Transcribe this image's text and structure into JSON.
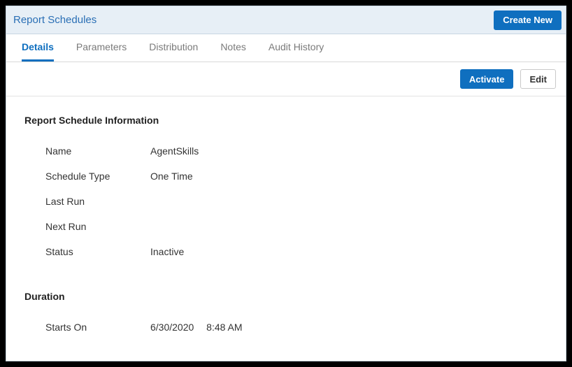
{
  "header": {
    "title": "Report Schedules",
    "create_label": "Create New"
  },
  "tabs": {
    "details": "Details",
    "parameters": "Parameters",
    "distribution": "Distribution",
    "notes": "Notes",
    "audit_history": "Audit History"
  },
  "actions": {
    "activate": "Activate",
    "edit": "Edit"
  },
  "sections": {
    "info_title": "Report Schedule Information",
    "duration_title": "Duration"
  },
  "fields": {
    "name": {
      "label": "Name",
      "value": "AgentSkills"
    },
    "schedule_type": {
      "label": "Schedule Type",
      "value": "One Time"
    },
    "last_run": {
      "label": "Last Run",
      "value": ""
    },
    "next_run": {
      "label": "Next Run",
      "value": ""
    },
    "status": {
      "label": "Status",
      "value": "Inactive"
    },
    "starts_on": {
      "label": "Starts On",
      "value": "6/30/2020  8:48 AM"
    }
  }
}
